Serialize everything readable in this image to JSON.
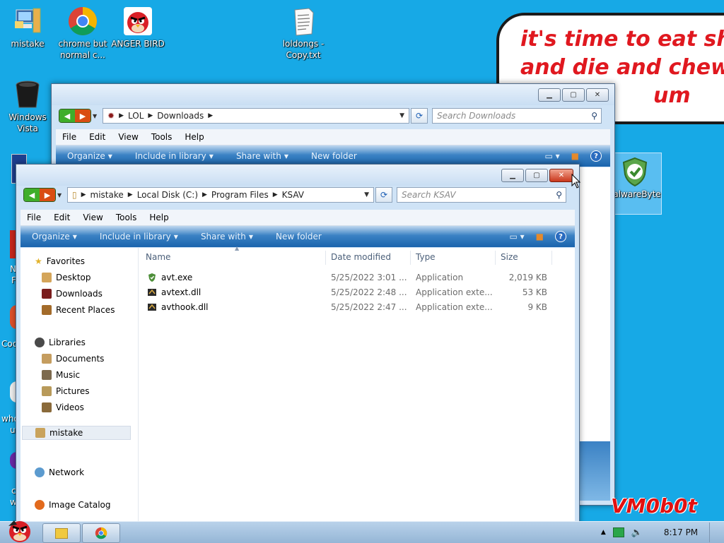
{
  "desktop": {
    "icons": [
      {
        "label": "mistake",
        "icon": "computer-icon"
      },
      {
        "label": "chrome but normal c...",
        "icon": "chrome-icon"
      },
      {
        "label": "ANGER BIRD",
        "icon": "angry-bird-icon"
      },
      {
        "label": "loldongs - Copy.txt",
        "icon": "text-file-icon"
      },
      {
        "label": "Windows Vista",
        "icon": "recycle-bin-icon"
      },
      {
        "label": "MalwareBytes",
        "icon": "shield-icon"
      }
    ],
    "partial_labels": {
      "n_letter": "N",
      "f_letter": "F",
      "coo": "Coo",
      "who": "who",
      "u": "u",
      "c": "c",
      "w": "w"
    },
    "bubble_text": "it's time to eat shit\nand die and chew\n                  um",
    "watermark": "VM0b0t"
  },
  "window_back": {
    "path": [
      "LOL",
      "Downloads"
    ],
    "search_placeholder": "Search Downloads",
    "menu": [
      "File",
      "Edit",
      "View",
      "Tools",
      "Help"
    ],
    "commands": [
      "Organize",
      "Include in library",
      "Share with",
      "New folder"
    ]
  },
  "window_front": {
    "path": [
      "mistake",
      "Local Disk (C:)",
      "Program Files",
      "KSAV"
    ],
    "search_placeholder": "Search KSAV",
    "menu": [
      "File",
      "Edit",
      "View",
      "Tools",
      "Help"
    ],
    "commands": [
      "Organize",
      "Include in library",
      "Share with",
      "New folder"
    ],
    "nav": {
      "favorites": "Favorites",
      "desktop": "Desktop",
      "downloads": "Downloads",
      "recent": "Recent Places",
      "libraries": "Libraries",
      "documents": "Documents",
      "music": "Music",
      "pictures": "Pictures",
      "videos": "Videos",
      "home": "mistake",
      "network": "Network",
      "image_catalog": "Image Catalog"
    },
    "columns": {
      "name": "Name",
      "date": "Date modified",
      "type": "Type",
      "size": "Size"
    },
    "files": [
      {
        "name": "avt.exe",
        "date": "5/25/2022 3:01 ...",
        "type": "Application",
        "size": "2,019 KB",
        "icon": "shield-exe-icon"
      },
      {
        "name": "avtext.dll",
        "date": "5/25/2022 2:48 ...",
        "type": "Application exte...",
        "size": "53 KB",
        "icon": "dll-icon"
      },
      {
        "name": "avthook.dll",
        "date": "5/25/2022 2:47 ...",
        "type": "Application exte...",
        "size": "9 KB",
        "icon": "dll-icon"
      }
    ]
  },
  "taskbar": {
    "time": "8:17 PM",
    "buttons": [
      "explorer-icon",
      "chrome-icon"
    ]
  },
  "colors": {
    "desktop_bg": "#17a9e6",
    "bubble_text": "#e0181f",
    "close_button": "#c9371c"
  }
}
